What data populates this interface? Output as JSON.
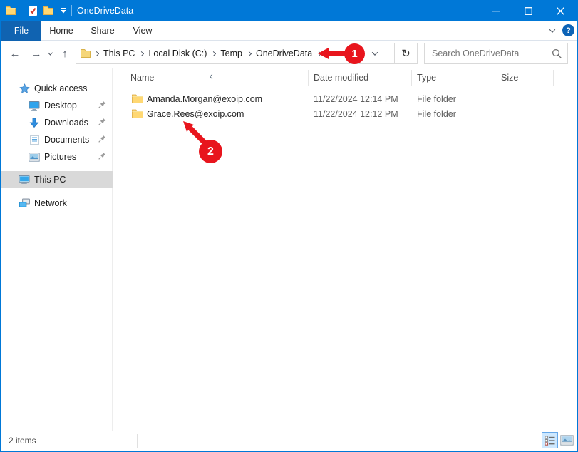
{
  "colors": {
    "accent": "#0078d7",
    "file_tab_blue": "#1063b1",
    "annotation_red": "#e8151d",
    "selection_gray": "#d9d9d9"
  },
  "titlebar": {
    "title": "OneDriveData"
  },
  "menubar": {
    "tabs": {
      "file": "File",
      "home": "Home",
      "share": "Share",
      "view": "View"
    },
    "help_label": "?"
  },
  "toolbar": {
    "nav": {
      "back": "←",
      "forward": "→",
      "up": "↑"
    },
    "address": {
      "crumbs": [
        "This PC",
        "Local Disk (C:)",
        "Temp",
        "OneDriveData"
      ],
      "refresh_glyph": "↻"
    },
    "search": {
      "placeholder": "Search OneDriveData"
    }
  },
  "sidebar": {
    "items": [
      {
        "label": "Quick access",
        "icon": "star-icon",
        "pinned": false,
        "selected": false
      },
      {
        "label": "Desktop",
        "icon": "desktop-icon",
        "pinned": true,
        "selected": false
      },
      {
        "label": "Downloads",
        "icon": "downloads-icon",
        "pinned": true,
        "selected": false
      },
      {
        "label": "Documents",
        "icon": "documents-icon",
        "pinned": true,
        "selected": false
      },
      {
        "label": "Pictures",
        "icon": "pictures-icon",
        "pinned": true,
        "selected": false
      },
      {
        "label": "This PC",
        "icon": "this-pc-icon",
        "pinned": false,
        "selected": true
      },
      {
        "label": "Network",
        "icon": "network-icon",
        "pinned": false,
        "selected": false
      }
    ]
  },
  "file_list": {
    "columns": {
      "name": "Name",
      "date_modified": "Date modified",
      "type": "Type",
      "size": "Size"
    },
    "sort": {
      "column": "Name",
      "direction": "ascending"
    },
    "rows": [
      {
        "name": "Amanda.Morgan@exoip.com",
        "date_modified": "11/22/2024 12:14 PM",
        "type": "File folder",
        "size": ""
      },
      {
        "name": "Grace.Rees@exoip.com",
        "date_modified": "11/22/2024 12:12 PM",
        "type": "File folder",
        "size": ""
      }
    ]
  },
  "statusbar": {
    "count": "2 items"
  },
  "annotations": {
    "step1": "1",
    "step2": "2"
  }
}
